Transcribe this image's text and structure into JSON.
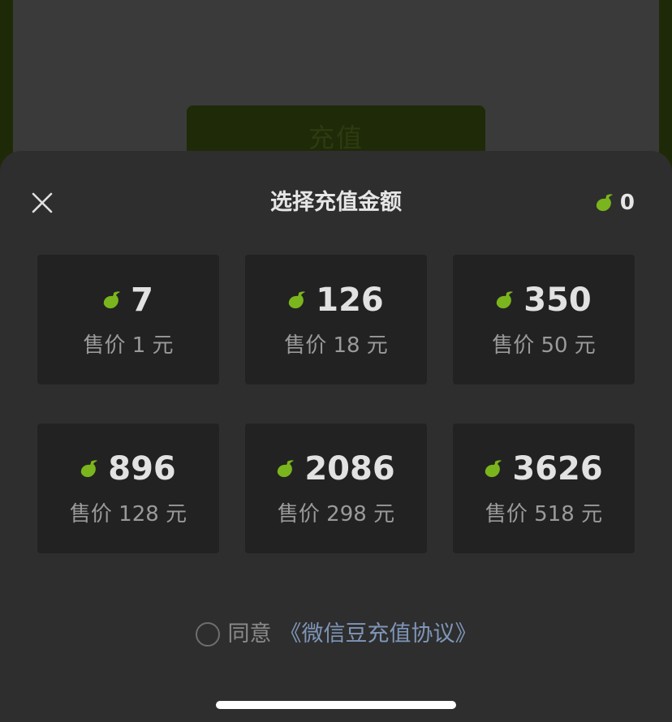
{
  "background": {
    "recharge_button_label": "充值"
  },
  "sheet": {
    "title": "选择充值金额",
    "balance": "0",
    "options": [
      {
        "amount": "7",
        "price": "售价 1 元"
      },
      {
        "amount": "126",
        "price": "售价 18 元"
      },
      {
        "amount": "350",
        "price": "售价 50 元"
      },
      {
        "amount": "896",
        "price": "售价 128 元"
      },
      {
        "amount": "2086",
        "price": "售价 298 元"
      },
      {
        "amount": "3626",
        "price": "售价 518 元"
      }
    ],
    "agreement": {
      "prefix": "同意",
      "link": "《微信豆充值协议》"
    }
  },
  "icons": {
    "close": "close-icon",
    "bean": "bean-icon"
  },
  "colors": {
    "bean": "#7ab51d",
    "link": "#7f96b8",
    "sheet": "#2e2e2e",
    "card": "#222222"
  }
}
